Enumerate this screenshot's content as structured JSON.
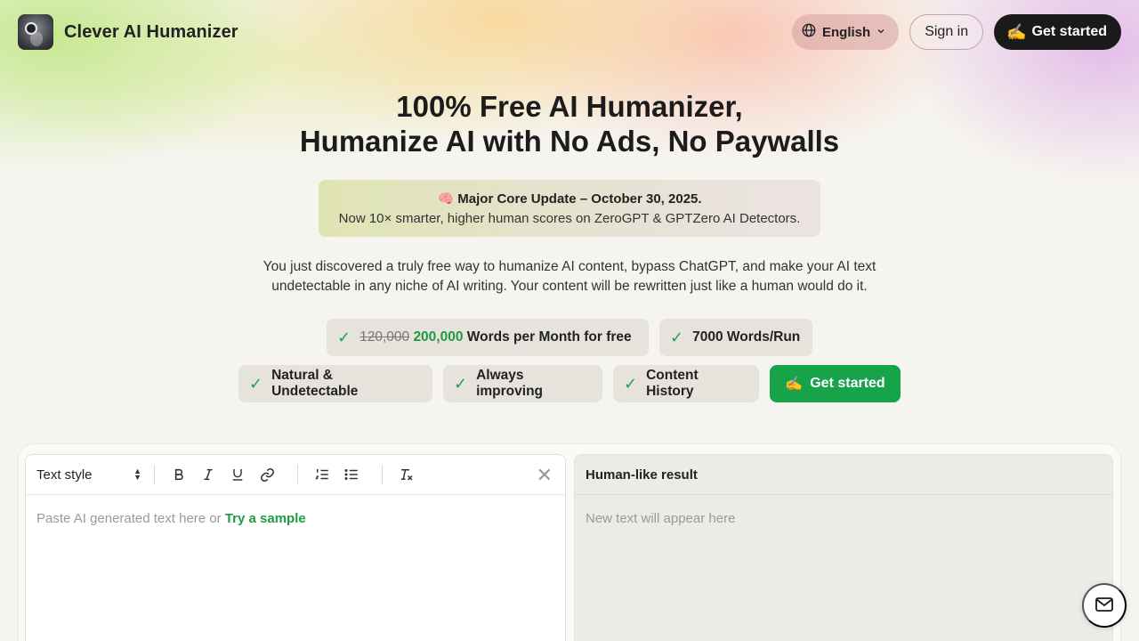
{
  "header": {
    "brand_name": "Clever AI Humanizer",
    "language": "English",
    "signin_label": "Sign in",
    "get_started_label": "Get started"
  },
  "hero": {
    "title_line1": "100% Free AI Humanizer,",
    "title_line2": "Humanize AI with No Ads, No Paywalls",
    "update_title": "🧠 Major Core Update – October 30, 2025.",
    "update_text": "Now 10× smarter, higher human scores on ZeroGPT & GPTZero AI Detectors.",
    "intro_text": "You just discovered a truly free way to humanize AI content, bypass ChatGPT, and make your AI text undetectable in any niche of AI writing. Your content will be rewritten just like a human would do it."
  },
  "features": {
    "words_old": "120,000",
    "words_new": "200,000",
    "words_suffix": "Words per Month for free",
    "words_per_run": "7000 Words/Run",
    "natural": "Natural & Undetectable",
    "improving": "Always improving",
    "history": "Content History",
    "cta_label": "Get started",
    "cta_emoji": "✍"
  },
  "editor": {
    "text_style_label": "Text style",
    "placeholder_prefix": "Paste AI generated text here or",
    "sample_link": "Try a sample"
  },
  "result": {
    "title": "Human-like result",
    "placeholder": "New text will appear here"
  },
  "colors": {
    "accent_green": "#16a34a",
    "dark_button": "#1a1a1a"
  }
}
